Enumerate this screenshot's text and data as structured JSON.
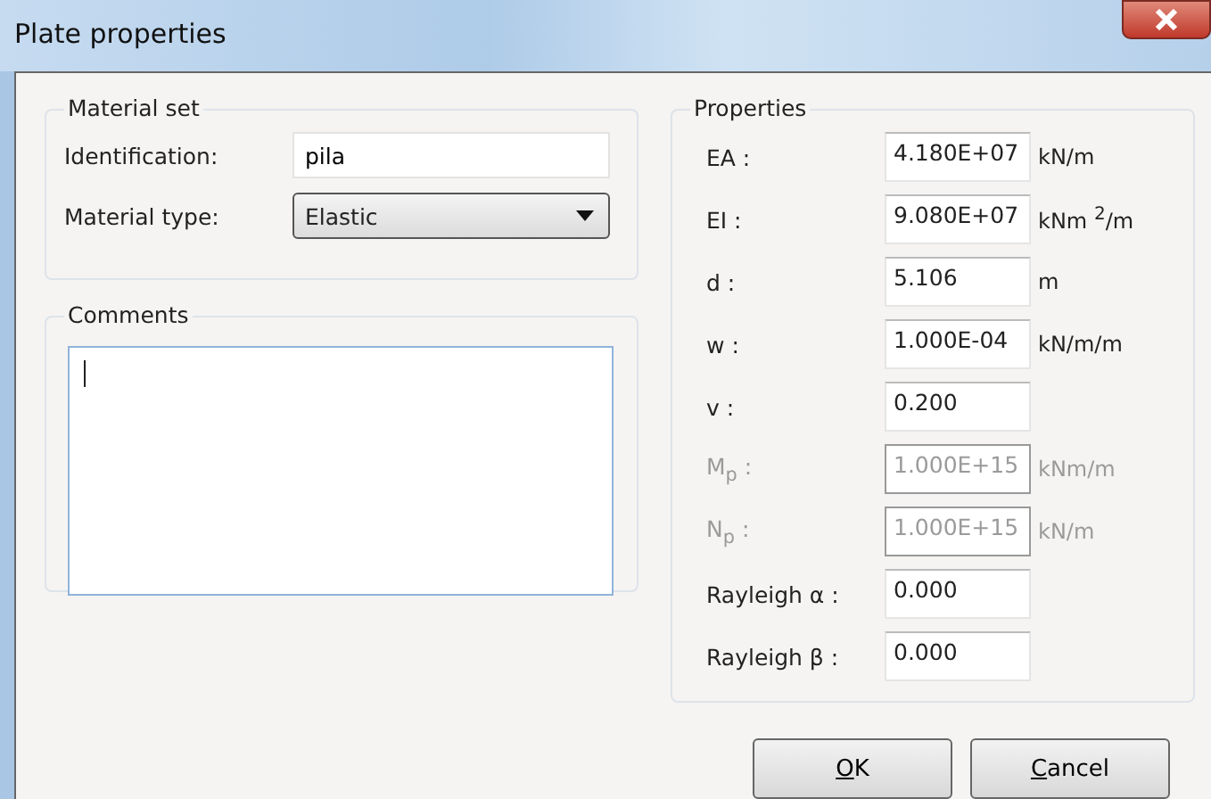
{
  "window": {
    "title": "Plate properties"
  },
  "material_set": {
    "title": "Material set",
    "identification": {
      "label": "Identification:",
      "value": "pila"
    },
    "material_type": {
      "label": "Material type:",
      "value": "Elastic"
    }
  },
  "comments": {
    "title": "Comments"
  },
  "properties": {
    "title": "Properties",
    "rows": [
      {
        "label": "EA :",
        "value": "4.180E+07",
        "unit": "kN/m",
        "disabled": false
      },
      {
        "label": "EI :",
        "value": "9.080E+07",
        "unit": "kNm $^{2}$/m",
        "disabled": false
      },
      {
        "label": "d :",
        "value": "5.106",
        "unit": "m",
        "disabled": false
      },
      {
        "label": "w :",
        "value": "1.000E-04",
        "unit": "kN/m/m",
        "disabled": false
      },
      {
        "label": "v :",
        "value": "0.200",
        "disabled": false
      },
      {
        "label": "M$_{p}$ :",
        "value": "1.000E+15",
        "unit": "kNm/m",
        "disabled": true
      },
      {
        "label": "N$_{p}$ :",
        "value": "1.000E+15",
        "unit": "kN/m",
        "disabled": true
      },
      {
        "label": "Rayleigh α :",
        "value": "0.000",
        "disabled": false
      },
      {
        "label": "Rayleigh β :",
        "value": "0.000",
        "disabled": false
      }
    ]
  },
  "buttons": [
    {
      "mnemonic": "O",
      "rest": "K"
    },
    {
      "mnemonic": "C",
      "rest": "ancel"
    }
  ]
}
